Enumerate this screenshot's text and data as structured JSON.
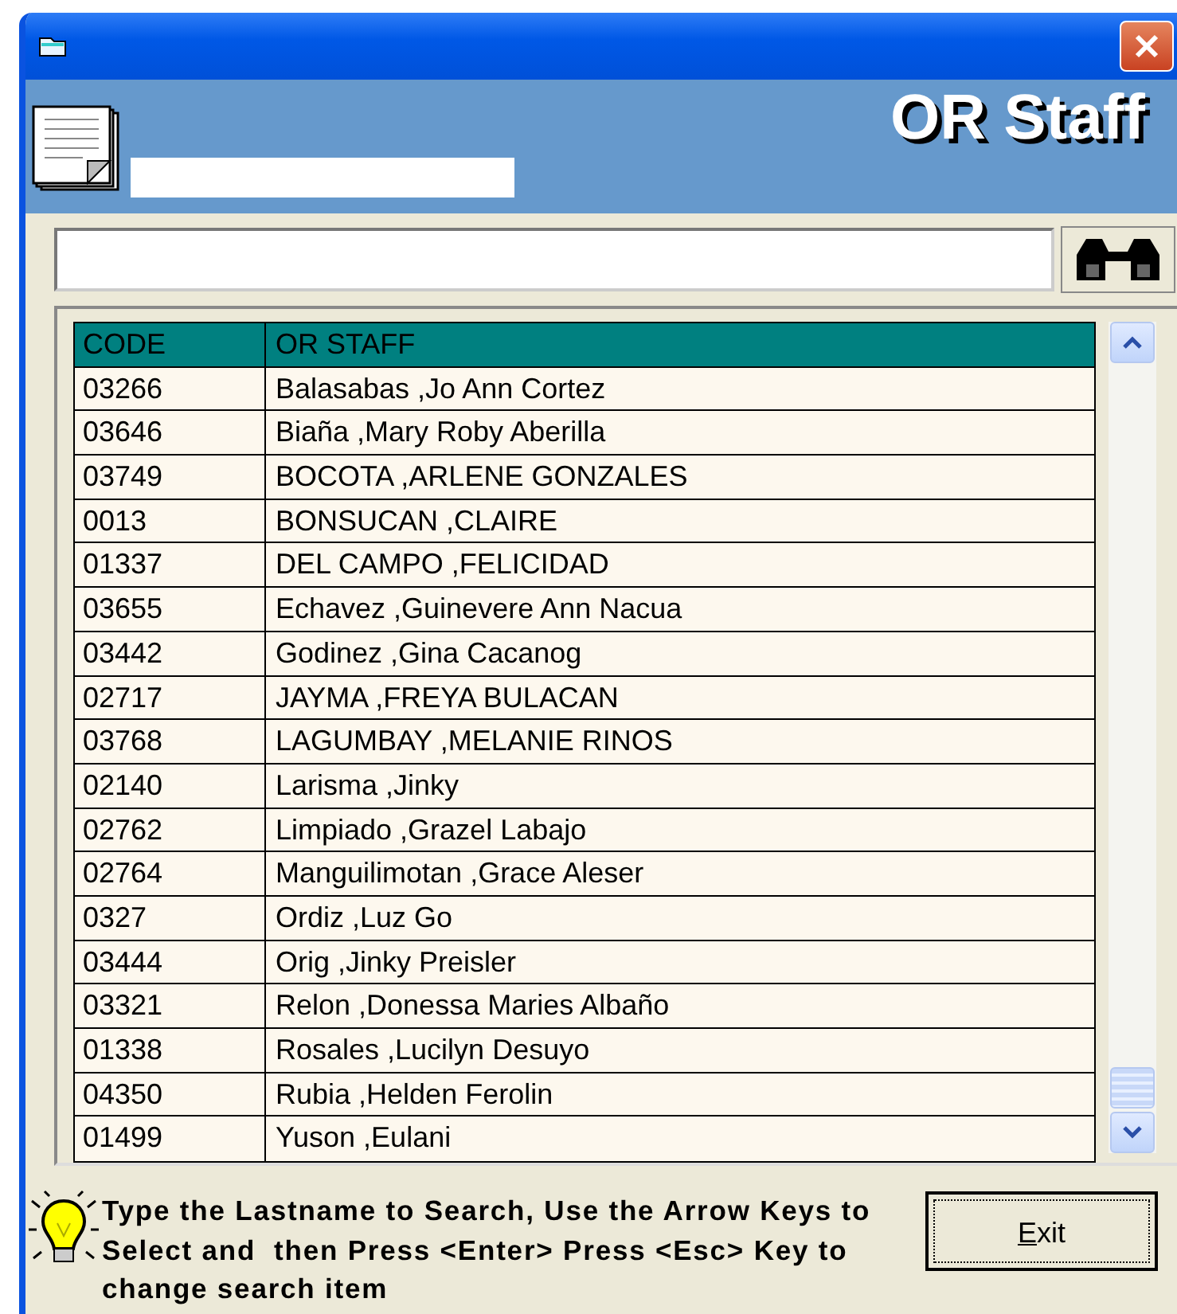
{
  "window": {
    "title": "OR Staff"
  },
  "table": {
    "columns": [
      "CODE",
      "OR STAFF"
    ],
    "rows": [
      [
        "03266",
        "Balasabas ,Jo Ann Cortez"
      ],
      [
        "03646",
        "Biaña ,Mary Roby Aberilla"
      ],
      [
        "03749",
        "BOCOTA ,ARLENE GONZALES"
      ],
      [
        "0013",
        "BONSUCAN ,CLAIRE"
      ],
      [
        "01337",
        "DEL CAMPO ,FELICIDAD"
      ],
      [
        "03655",
        "Echavez ,Guinevere Ann Nacua"
      ],
      [
        "03442",
        "Godinez ,Gina Cacanog"
      ],
      [
        "02717",
        "JAYMA ,FREYA BULACAN"
      ],
      [
        "03768",
        "LAGUMBAY ,MELANIE RINOS"
      ],
      [
        "02140",
        "Larisma ,Jinky"
      ],
      [
        "02762",
        "Limpiado ,Grazel Labajo"
      ],
      [
        "02764",
        "Manguilimotan ,Grace Aleser"
      ],
      [
        "0327",
        "Ordiz ,Luz Go"
      ],
      [
        "03444",
        "Orig ,Jinky Preisler"
      ],
      [
        "03321",
        "Relon ,Donessa Maries Albaño"
      ],
      [
        "01338",
        "Rosales ,Lucilyn Desuyo"
      ],
      [
        "04350",
        "Rubia ,Helden Ferolin"
      ],
      [
        "01499",
        "Yuson ,Eulani"
      ]
    ]
  },
  "hint": "Type the Lastname to Search, Use the Arrow Keys to Select and  then Press <Enter> Press <Esc> Key to change search item",
  "buttons": [
    "Exit"
  ]
}
